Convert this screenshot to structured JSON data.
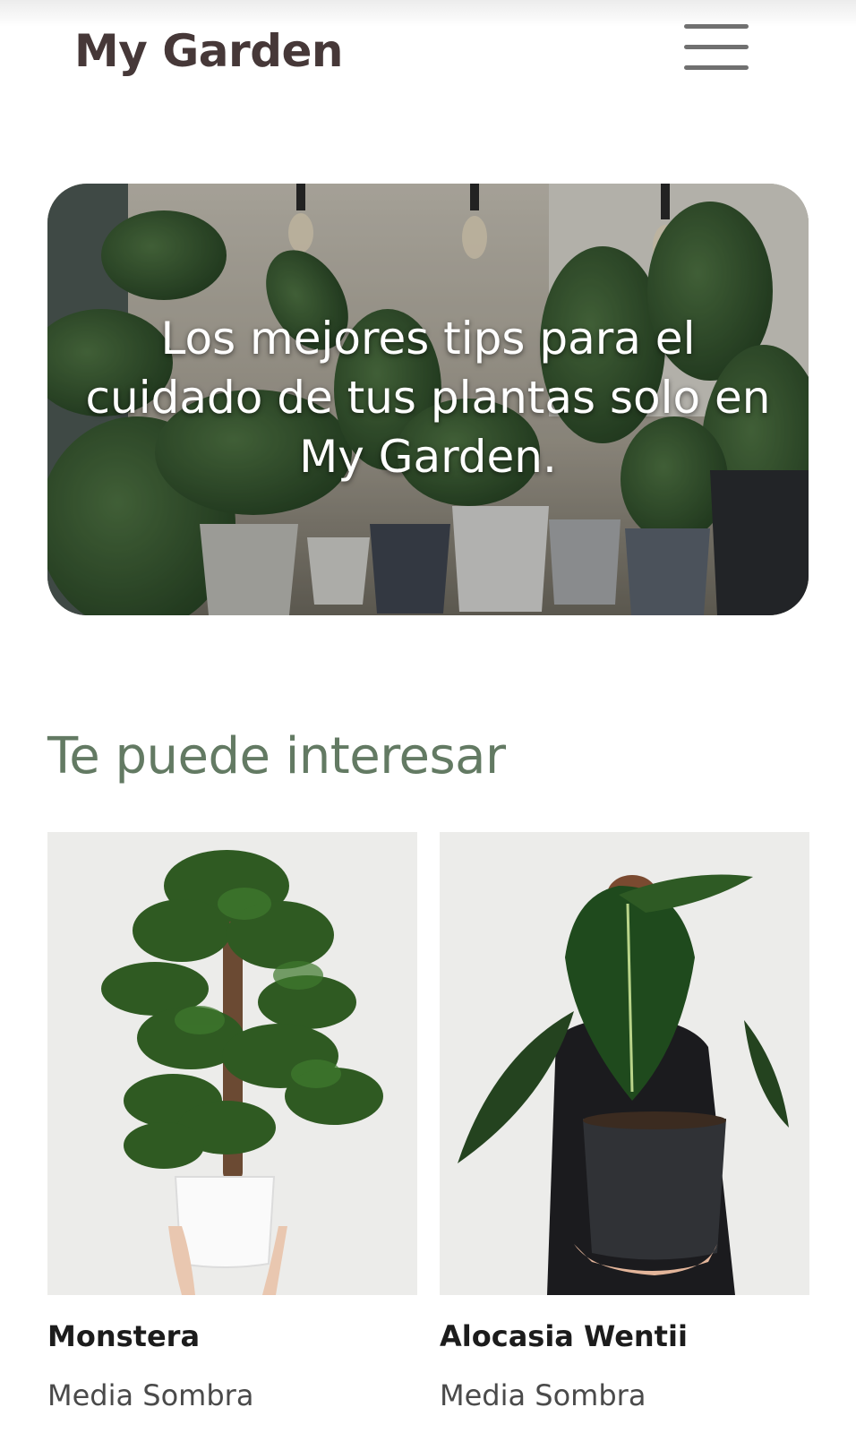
{
  "header": {
    "title": "My Garden",
    "menu_icon": "hamburger-menu-icon"
  },
  "hero": {
    "text": "Los mejores tips para el cuidado de tus plantas solo en My Garden."
  },
  "section": {
    "title": "Te puede interesar"
  },
  "plants": [
    {
      "name": "Monstera",
      "light": "Media Sombra"
    },
    {
      "name": "Alocasia Wentii",
      "light": "Media Sombra"
    }
  ],
  "colors": {
    "title": "#463838",
    "accent": "#637a63",
    "menu": "#707070"
  }
}
